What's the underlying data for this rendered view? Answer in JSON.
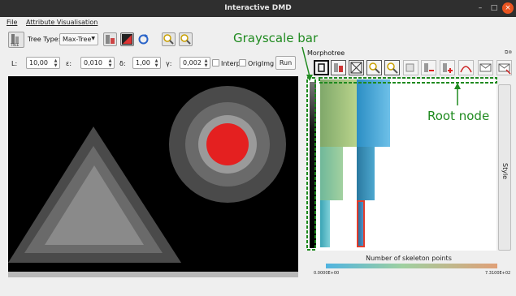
{
  "window": {
    "title": "Interactive DMD"
  },
  "menu": {
    "file": "File",
    "attr_vis": "Attribute Visualisation"
  },
  "toolbar": {
    "tree_type_label": "Tree Type:",
    "tree_type_value": "Max-Tree",
    "tree_icon_text": "TREE"
  },
  "params": {
    "l_label": "L:",
    "l_value": "10,00",
    "eps_label": "ε:",
    "eps_value": "0,010",
    "delta_label": "δ:",
    "delta_value": "1,00",
    "gamma_label": "γ:",
    "gamma_value": "0,002",
    "interp_label": "Interp",
    "origimg_label": "OrigImg",
    "run_label": "Run"
  },
  "panel": {
    "title": "Morphotree",
    "style_tab": "Style"
  },
  "colorbar": {
    "title": "Number of skeleton points",
    "min": "0.0000E+00",
    "max": "7.3100E+02"
  },
  "annotations": {
    "grayscale": "Grayscale bar",
    "root": "Root node"
  },
  "colors": {
    "annotation": "#1f8a1f",
    "highlight": "#e23c2c",
    "titlebar": "#2f2f2f",
    "close": "#e95420"
  }
}
